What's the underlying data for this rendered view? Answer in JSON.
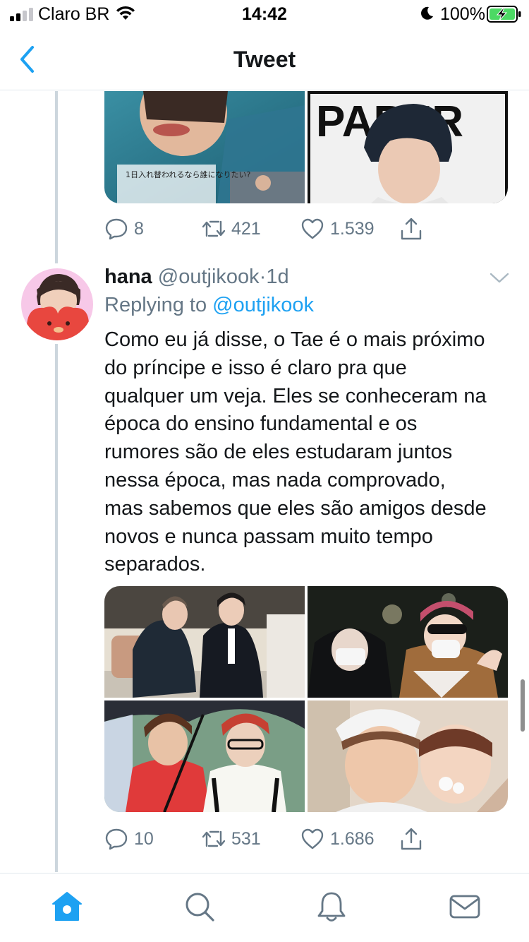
{
  "status_bar": {
    "carrier": "Claro BR",
    "time": "14:42",
    "battery": "100%"
  },
  "nav": {
    "title": "Tweet",
    "back_icon": "chevron-left-icon"
  },
  "previous_tweet": {
    "actions": {
      "replies": "8",
      "retweets": "421",
      "likes": "1.539"
    }
  },
  "tweet": {
    "display_name": "hana",
    "handle": "@outjikook",
    "separator": "·",
    "time": "1d",
    "replying_prefix": "Replying to",
    "replying_to": "@outjikook",
    "text_lines": [
      "Como eu já disse, o Tae é o mais próximo",
      "do príncipe e isso é claro pra que",
      "qualquer um veja. Eles se conheceram na",
      "época do ensino fundamental e os",
      "rumores são de eles estudaram juntos",
      "nessa época, mas nada comprovado,",
      "mas sabemos que eles são amigos desde",
      "novos e nunca passam muito tempo",
      "separados."
    ],
    "actions": {
      "replies": "10",
      "retweets": "531",
      "likes": "1.686"
    }
  },
  "tab_bar": {
    "items": [
      "home-icon",
      "search-icon",
      "notifications-icon",
      "messages-icon"
    ],
    "accent": "#1da1f2"
  },
  "colors": {
    "accent": "#1da1f2",
    "secondary_text": "#657786",
    "primary_text": "#14171a",
    "divider": "#e1e8ed",
    "battery_green": "#4cd964"
  },
  "previous_media": {
    "photo_2_text": "PAPER",
    "photo_1_caption": "1日入れ替われるなら誰になりたい?"
  }
}
